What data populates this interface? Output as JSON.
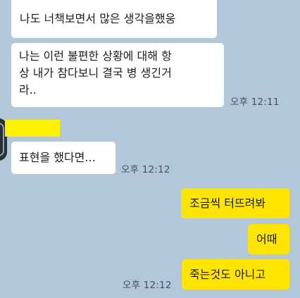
{
  "messages": {
    "m1": {
      "text": "나도 너책보면서 많은 생각을했웅"
    },
    "m2": {
      "line1": "나는 이런 불편한 상황에 대해 항",
      "line2": "상 내가 참다보니 결국 병 생긴거",
      "line3": "라.."
    },
    "m2_time": "오후 12:11",
    "m3": {
      "text": "표현을 했다면..."
    },
    "m3_time": "오후 12:12",
    "m4": {
      "text": "조금씩 터뜨려봐"
    },
    "m5": {
      "text": "어때"
    },
    "m6": {
      "text": "죽는것도 아니고"
    },
    "m6_time": "오후 12:12"
  },
  "colors": {
    "background": "#b2c7da",
    "incoming_bubble": "#ffffff",
    "outgoing_bubble": "#fee500",
    "name_redaction": "#fff200"
  }
}
